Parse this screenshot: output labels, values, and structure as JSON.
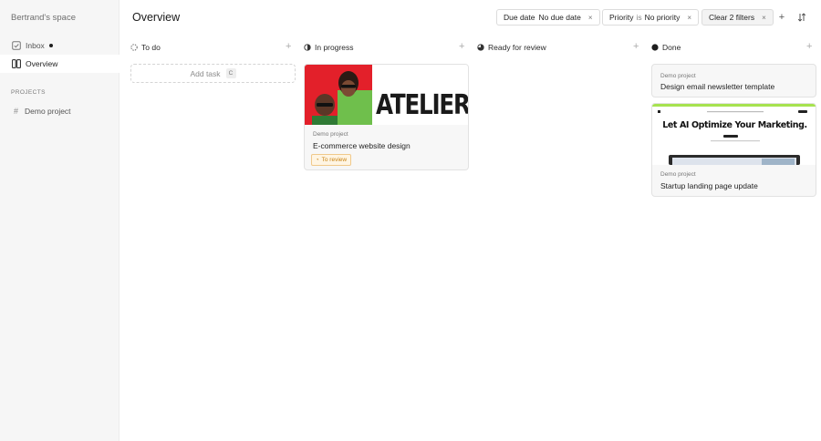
{
  "sidebar": {
    "space_name": "Bertrand's space",
    "nav": [
      {
        "label": "Inbox",
        "icon": "inbox-icon"
      },
      {
        "label": "Overview",
        "icon": "board-icon"
      }
    ],
    "projects_title": "PROJECTS",
    "projects": [
      {
        "label": "Demo project",
        "icon": "hash-icon"
      }
    ]
  },
  "header": {
    "title": "Overview",
    "filters": {
      "due_date": {
        "field": "Due date",
        "value": "No due date"
      },
      "priority": {
        "field": "Priority",
        "op": "is",
        "value": "No priority"
      },
      "clear": "Clear 2 filters"
    },
    "remove_glyph": "×",
    "add_glyph": "+",
    "sort_icon": "sort-icon"
  },
  "columns": [
    {
      "label": "To do",
      "status_icon": "status-todo-icon"
    },
    {
      "label": "In progress",
      "status_icon": "status-in-progress-icon"
    },
    {
      "label": "Ready for review",
      "status_icon": "status-review-icon"
    },
    {
      "label": "Done",
      "status_icon": "status-done-icon"
    }
  ],
  "add_task": {
    "label": "Add task",
    "shortcut": "C"
  },
  "cards": {
    "ecommerce": {
      "project": "Demo project",
      "title": "E-commerce website design",
      "tag": "To review",
      "thumb_text": "ATELIER"
    },
    "newsletter": {
      "project": "Demo project",
      "title": "Design email newsletter template"
    },
    "landing": {
      "project": "Demo project",
      "title": "Startup landing page update",
      "thumb_text": "Let AI Optimize Your Marketing."
    }
  },
  "colors": {
    "accent_red": "#e3202a",
    "accent_green": "#a6e24f",
    "tag_orange": "#c98416"
  }
}
